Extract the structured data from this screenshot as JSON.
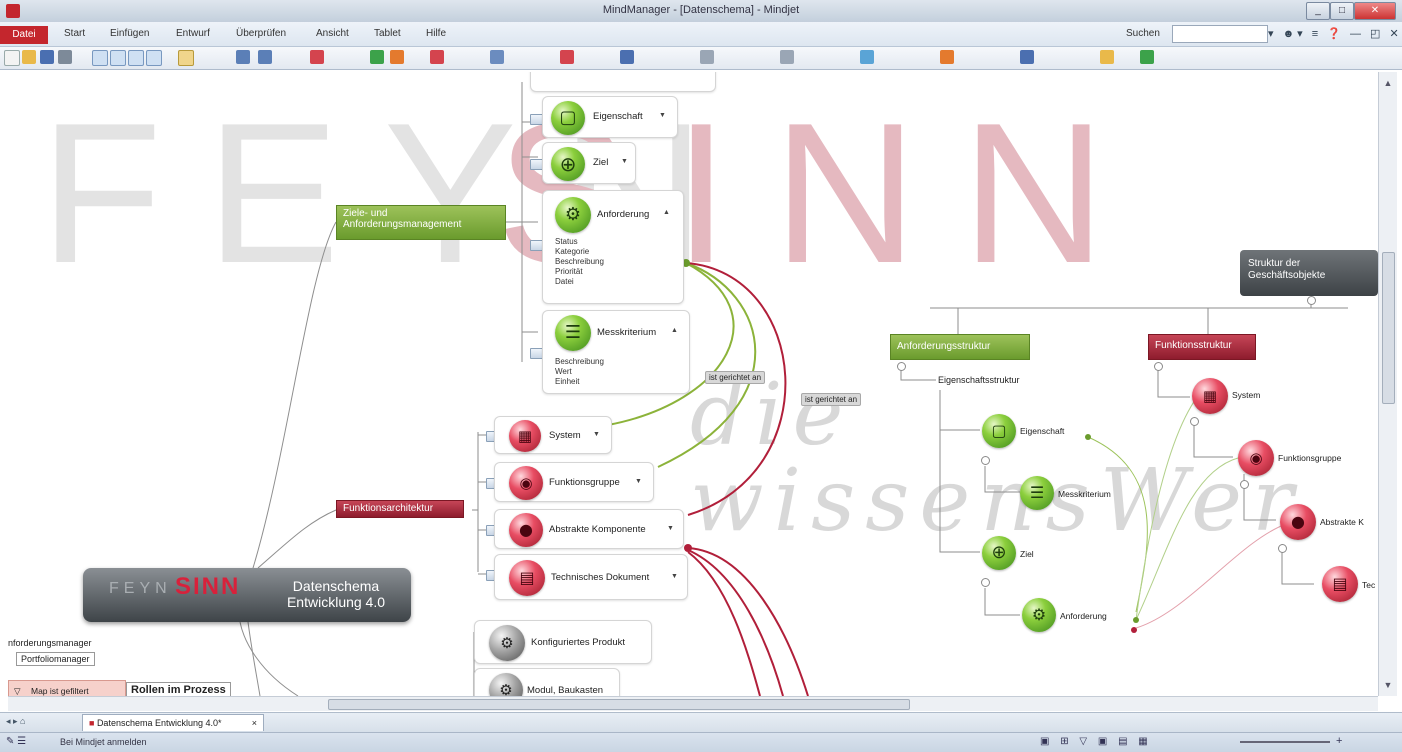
{
  "window": {
    "title": "MindManager - [Datenschema] - Mindjet"
  },
  "menu": {
    "file": "Datei",
    "items": [
      "Start",
      "Einfügen",
      "Entwurf",
      "Überprüfen",
      "Ansicht",
      "Tablet",
      "Hilfe"
    ],
    "search_label": "Suchen"
  },
  "watermark": {
    "feyn": "FEYN",
    "sinn": "SINN",
    "tagline": "die wissensWer"
  },
  "central": {
    "logo_feyn": "FEYN",
    "logo_sinn": "SINN",
    "title_line1": "Datenschema",
    "title_line2": "Entwicklung 4.0"
  },
  "branches": {
    "ziele": {
      "line1": "Ziele- und",
      "line2": "Anforderungsmanagement"
    },
    "funktion": "Funktionsarchitektur",
    "struktur": {
      "line1": "Struktur der",
      "line2": "Geschäftsobjekte"
    },
    "anforderungsstruktur": "Anforderungsstruktur",
    "funktionsstruktur": "Funktionsstruktur"
  },
  "topics": {
    "eigenschaft": "Eigenschaft",
    "ziel": "Ziel",
    "anforderung": "Anforderung",
    "messkriterium": "Messkriterium",
    "system": "System",
    "funktionsgruppe": "Funktionsgruppe",
    "abstrakte": "Abstrakte Komponente",
    "technisches": "Technisches Dokument",
    "konfiguriertes": "Konfiguriertes Produkt",
    "modul": "Modul, Baukasten"
  },
  "anforderung_fields": [
    "Status",
    "Kategorie",
    "Beschreibung",
    "Priorität",
    "Datei"
  ],
  "messkriterium_fields": [
    "Beschreibung",
    "Wert",
    "Einheit"
  ],
  "relations": {
    "r1": "ist gerichtet an",
    "r2": "ist gerichtet an"
  },
  "right_tree": {
    "eigenschaftsstruktur": "Eigenschaftsstruktur",
    "eigenschaft": "Eigenschaft",
    "messkriterium": "Messkriterium",
    "ziel": "Ziel",
    "anforderung": "Anforderung",
    "system": "System",
    "funktionsgruppe": "Funktionsgruppe",
    "abstrakte": "Abstrakte K",
    "technisches": "Tec"
  },
  "left_stubs": {
    "anforderungsmanager": "nforderungsmanager",
    "portfoliomanager": "Portfoliomanager",
    "rollen": "Rollen im Prozess",
    "filter": "Map ist gefiltert"
  },
  "doc_tab": "Datenschema Entwicklung 4.0*",
  "status": {
    "message": "Bei Mindjet anmelden"
  },
  "colors": {
    "green": "#6a9b2d",
    "red": "#8e1c2d",
    "grey": "#4a4f53"
  }
}
